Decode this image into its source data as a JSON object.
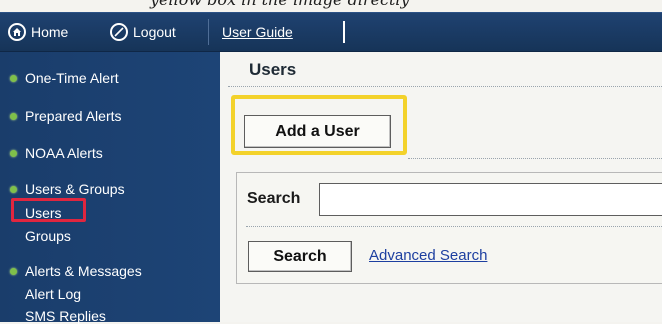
{
  "caption": "yellow box in the image directly",
  "topbar": {
    "home_label": "Home",
    "logout_label": "Logout",
    "user_guide_label": "User Guide"
  },
  "sidebar": {
    "items": [
      {
        "label": "One-Time Alert"
      },
      {
        "label": "Prepared Alerts"
      },
      {
        "label": "NOAA Alerts"
      },
      {
        "label": "Users & Groups",
        "children": [
          "Users",
          "Groups"
        ]
      },
      {
        "label": "Alerts & Messages",
        "children": [
          "Alert Log",
          "SMS Replies"
        ]
      }
    ]
  },
  "main": {
    "title": "Users",
    "add_user_label": "Add a User",
    "search_label": "Search",
    "search_value": "",
    "search_button_label": "Search",
    "advanced_search_label": "Advanced Search"
  },
  "colors": {
    "nav_bg": "#1a3d6b",
    "highlight_yellow": "#f3d22b",
    "highlight_red": "#e0263f",
    "link_blue": "#1d3fa0"
  }
}
